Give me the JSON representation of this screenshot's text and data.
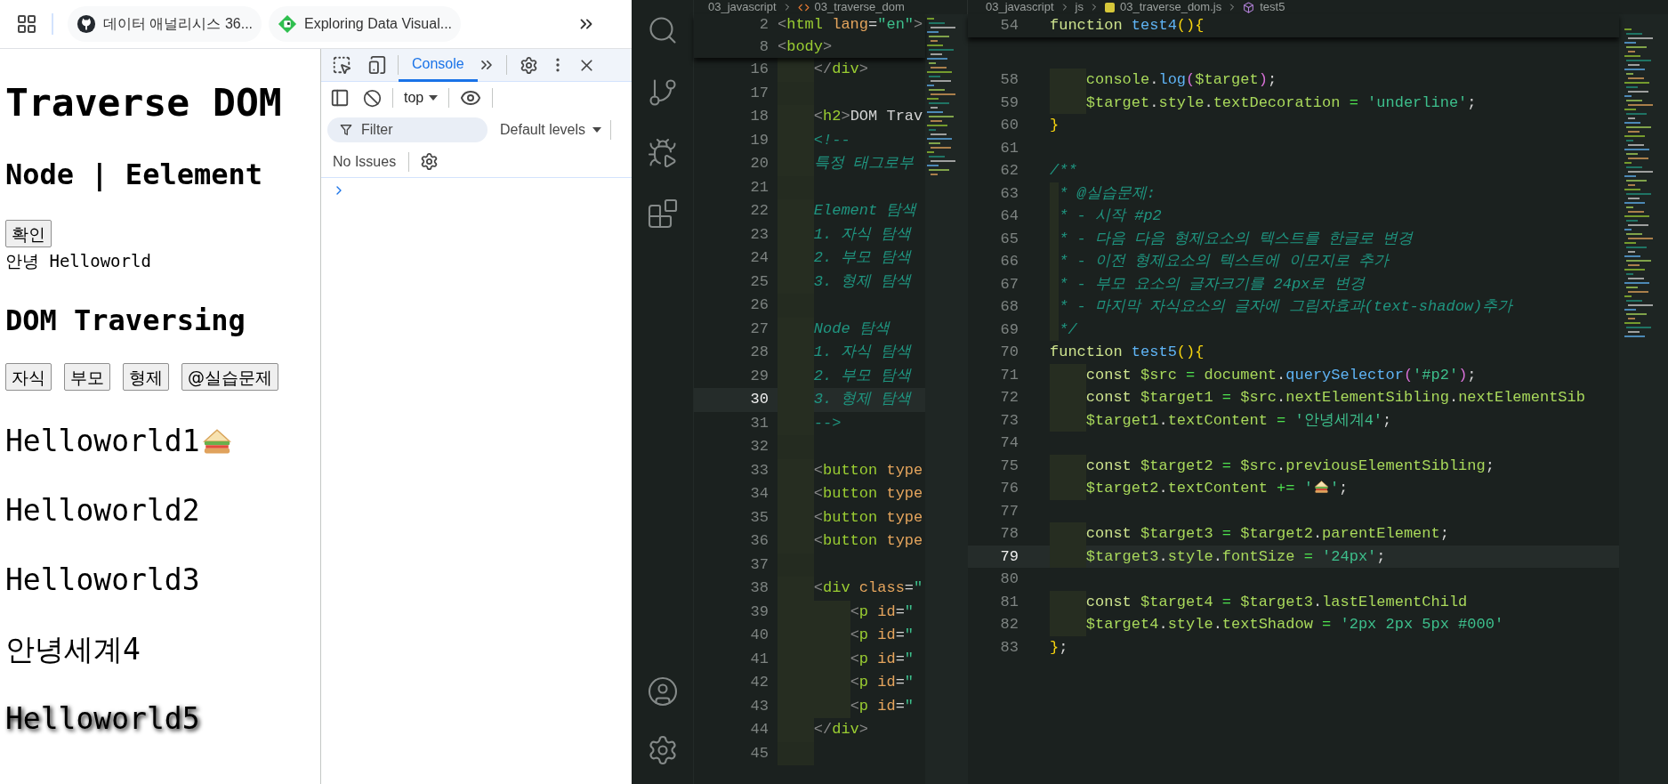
{
  "browser": {
    "bookmarks": [
      {
        "label": "데이터 애널리시스 36...",
        "kind": "github"
      },
      {
        "label": "Exploring Data Visual...",
        "kind": "site"
      }
    ],
    "page": {
      "title": "Traverse DOM",
      "subtitle": "Node | Eelement",
      "confirm_button": "확인",
      "greeting": "안녕 Helloworld",
      "section_title": "DOM Traversing",
      "buttons": [
        "자식",
        "부모",
        "형제",
        "@실습문제"
      ],
      "paragraphs": [
        {
          "text": "Helloworld1",
          "trailing_icon": true,
          "shadow": false
        },
        {
          "text": "Helloworld2",
          "trailing_icon": false,
          "shadow": false
        },
        {
          "text": "Helloworld3",
          "trailing_icon": false,
          "shadow": false
        },
        {
          "text": "안녕세계4",
          "trailing_icon": false,
          "shadow": false
        },
        {
          "text": "Helloworld5",
          "trailing_icon": false,
          "shadow": true
        }
      ]
    },
    "devtools": {
      "tabs": [
        {
          "label": "Console",
          "selected": true
        }
      ],
      "context": "top",
      "filter": {
        "placeholder": "Filter"
      },
      "levels": "Default levels",
      "issues": "No Issues"
    }
  },
  "editor": {
    "left": {
      "breadcrumb": [
        {
          "label": "03_javascript",
          "kind": "folder"
        },
        {
          "label": "03_traverse_dom",
          "kind": "html"
        }
      ],
      "sticky": [
        {
          "number": "2",
          "current": false,
          "code": [
            {
              "text": "<",
              "kind": "angle"
            },
            {
              "text": "html",
              "kind": "tag"
            },
            {
              "text": " lang",
              "kind": "attr"
            },
            {
              "text": "=",
              "kind": "punct"
            },
            {
              "text": "\"en\"",
              "kind": "str"
            },
            {
              "text": ">",
              "kind": "angle"
            }
          ]
        },
        {
          "number": "8",
          "current": false,
          "code": [
            {
              "text": "<",
              "kind": "angle"
            },
            {
              "text": "body",
              "kind": "tag"
            },
            {
              "text": ">",
              "kind": "angle"
            }
          ]
        }
      ],
      "lines": [
        {
          "number": "16",
          "current": false,
          "code": [
            {
              "text": "    </",
              "kind": "angle"
            },
            {
              "text": "div",
              "kind": "tag"
            },
            {
              "text": ">",
              "kind": "angle"
            }
          ]
        },
        {
          "number": "17",
          "current": false
        },
        {
          "number": "18",
          "current": false,
          "code": [
            {
              "text": "    <",
              "kind": "angle"
            },
            {
              "text": "h2",
              "kind": "tag"
            },
            {
              "text": ">",
              "kind": "angle"
            },
            {
              "text": "DOM Trav",
              "kind": "text"
            }
          ]
        },
        {
          "number": "19",
          "current": false,
          "code": [
            {
              "text": "    <!--",
              "kind": "comment"
            }
          ]
        },
        {
          "number": "20",
          "current": false,
          "code": [
            {
              "text": "    특정 태그로부",
              "kind": "comment"
            }
          ]
        },
        {
          "number": "21",
          "current": false
        },
        {
          "number": "22",
          "current": false,
          "code": [
            {
              "text": "    Element 탐색",
              "kind": "comment"
            }
          ]
        },
        {
          "number": "23",
          "current": false,
          "code": [
            {
              "text": "    1. 자식 탐색",
              "kind": "comment"
            }
          ]
        },
        {
          "number": "24",
          "current": false,
          "code": [
            {
              "text": "    2. 부모 탐색",
              "kind": "comment"
            }
          ]
        },
        {
          "number": "25",
          "current": false,
          "code": [
            {
              "text": "    3. 형제 탐색",
              "kind": "comment"
            }
          ]
        },
        {
          "number": "26",
          "current": false
        },
        {
          "number": "27",
          "current": false,
          "code": [
            {
              "text": "    Node 탐색",
              "kind": "comment"
            }
          ]
        },
        {
          "number": "28",
          "current": false,
          "code": [
            {
              "text": "    1. 자식 탐색",
              "kind": "comment"
            }
          ]
        },
        {
          "number": "29",
          "current": false,
          "code": [
            {
              "text": "    2. 부모 탐색",
              "kind": "comment"
            }
          ]
        },
        {
          "number": "30",
          "current": true,
          "code": [
            {
              "text": "    3. 형제 탐색",
              "kind": "comment"
            }
          ]
        },
        {
          "number": "31",
          "current": false,
          "code": [
            {
              "text": "    -->",
              "kind": "comment"
            }
          ]
        },
        {
          "number": "32",
          "current": false
        },
        {
          "number": "33",
          "current": false,
          "code": [
            {
              "text": "    <",
              "kind": "angle"
            },
            {
              "text": "button",
              "kind": "tag"
            },
            {
              "text": " type",
              "kind": "attr"
            }
          ]
        },
        {
          "number": "34",
          "current": false,
          "code": [
            {
              "text": "    <",
              "kind": "angle"
            },
            {
              "text": "button",
              "kind": "tag"
            },
            {
              "text": " type",
              "kind": "attr"
            }
          ]
        },
        {
          "number": "35",
          "current": false,
          "code": [
            {
              "text": "    <",
              "kind": "angle"
            },
            {
              "text": "button",
              "kind": "tag"
            },
            {
              "text": " type",
              "kind": "attr"
            }
          ]
        },
        {
          "number": "36",
          "current": false,
          "code": [
            {
              "text": "    <",
              "kind": "angle"
            },
            {
              "text": "button",
              "kind": "tag"
            },
            {
              "text": " type",
              "kind": "attr"
            }
          ]
        },
        {
          "number": "37",
          "current": false
        },
        {
          "number": "38",
          "current": false,
          "code": [
            {
              "text": "    <",
              "kind": "angle"
            },
            {
              "text": "div",
              "kind": "tag"
            },
            {
              "text": " class",
              "kind": "attr"
            },
            {
              "text": "=",
              "kind": "punct"
            },
            {
              "text": "\"",
              "kind": "str"
            }
          ]
        },
        {
          "number": "39",
          "current": false,
          "code": [
            {
              "text": "        <",
              "kind": "angle"
            },
            {
              "text": "p",
              "kind": "tag"
            },
            {
              "text": " id",
              "kind": "attr"
            },
            {
              "text": "=",
              "kind": "punct"
            },
            {
              "text": "\"",
              "kind": "str"
            }
          ]
        },
        {
          "number": "40",
          "current": false,
          "code": [
            {
              "text": "        <",
              "kind": "angle"
            },
            {
              "text": "p",
              "kind": "tag"
            },
            {
              "text": " id",
              "kind": "attr"
            },
            {
              "text": "=",
              "kind": "punct"
            },
            {
              "text": "\"",
              "kind": "str"
            }
          ]
        },
        {
          "number": "41",
          "current": false,
          "code": [
            {
              "text": "        <",
              "kind": "angle"
            },
            {
              "text": "p",
              "kind": "tag"
            },
            {
              "text": " id",
              "kind": "attr"
            },
            {
              "text": "=",
              "kind": "punct"
            },
            {
              "text": "\"",
              "kind": "str"
            }
          ]
        },
        {
          "number": "42",
          "current": false,
          "code": [
            {
              "text": "        <",
              "kind": "angle"
            },
            {
              "text": "p",
              "kind": "tag"
            },
            {
              "text": " id",
              "kind": "attr"
            },
            {
              "text": "=",
              "kind": "punct"
            },
            {
              "text": "\"",
              "kind": "str"
            }
          ]
        },
        {
          "number": "43",
          "current": false,
          "code": [
            {
              "text": "        <",
              "kind": "angle"
            },
            {
              "text": "p",
              "kind": "tag"
            },
            {
              "text": " id",
              "kind": "attr"
            },
            {
              "text": "=",
              "kind": "punct"
            },
            {
              "text": "\"",
              "kind": "str"
            }
          ]
        },
        {
          "number": "44",
          "current": false,
          "code": [
            {
              "text": "    </",
              "kind": "angle"
            },
            {
              "text": "div",
              "kind": "tag"
            },
            {
              "text": ">",
              "kind": "angle"
            }
          ]
        },
        {
          "number": "45",
          "current": false
        }
      ]
    },
    "right": {
      "breadcrumb": [
        {
          "label": "03_javascript",
          "kind": "folder"
        },
        {
          "label": "js",
          "kind": "folder"
        },
        {
          "label": "03_traverse_dom.js",
          "kind": "js"
        },
        {
          "label": "test5",
          "kind": "function"
        }
      ],
      "sticky": [
        {
          "number": "54",
          "current": false,
          "code": [
            {
              "text": "function",
              "kind": "kw"
            },
            {
              "text": " test4",
              "kind": "fn"
            },
            {
              "text": "(){",
              "kind": "brace"
            }
          ]
        }
      ],
      "lines": [
        {
          "number": "58",
          "current": false,
          "code": [
            {
              "text": "    console",
              "kind": "var"
            },
            {
              "text": ".",
              "kind": "punct"
            },
            {
              "text": "log",
              "kind": "fn"
            },
            {
              "text": "(",
              "kind": "paren"
            },
            {
              "text": "$target",
              "kind": "var"
            },
            {
              "text": ")",
              "kind": "paren"
            },
            {
              "text": ";",
              "kind": "punct"
            }
          ]
        },
        {
          "number": "59",
          "current": false,
          "code": [
            {
              "text": "    $target",
              "kind": "var"
            },
            {
              "text": ".",
              "kind": "punct"
            },
            {
              "text": "style",
              "kind": "var"
            },
            {
              "text": ".",
              "kind": "punct"
            },
            {
              "text": "textDecoration",
              "kind": "var"
            },
            {
              "text": " = ",
              "kind": "op"
            },
            {
              "text": "'underline'",
              "kind": "str"
            },
            {
              "text": ";",
              "kind": "punct"
            }
          ]
        },
        {
          "number": "60",
          "current": false,
          "code": [
            {
              "text": "}",
              "kind": "brace"
            }
          ]
        },
        {
          "number": "61",
          "current": false
        },
        {
          "number": "62",
          "current": false,
          "code": [
            {
              "text": "/**",
              "kind": "comment"
            }
          ]
        },
        {
          "number": "63",
          "current": false,
          "code": [
            {
              "text": " * @실습문제:",
              "kind": "comment"
            }
          ]
        },
        {
          "number": "64",
          "current": false,
          "code": [
            {
              "text": " * - 시작 #p2",
              "kind": "comment"
            }
          ]
        },
        {
          "number": "65",
          "current": false,
          "code": [
            {
              "text": " * - 다음 다음 형제요소의 텍스트를 한글로 변경",
              "kind": "comment"
            }
          ]
        },
        {
          "number": "66",
          "current": false,
          "code": [
            {
              "text": " * - 이전 형제요소의 텍스트에 이모지로 추가",
              "kind": "comment"
            }
          ]
        },
        {
          "number": "67",
          "current": false,
          "code": [
            {
              "text": " * - 부모 요소의 글자크기를 24px로 변경",
              "kind": "comment"
            }
          ]
        },
        {
          "number": "68",
          "current": false,
          "code": [
            {
              "text": " * - 마지막 자식요소의 글자에 그림자효과(text-shadow)추가",
              "kind": "comment"
            }
          ]
        },
        {
          "number": "69",
          "current": false,
          "code": [
            {
              "text": " */",
              "kind": "comment"
            }
          ]
        },
        {
          "number": "70",
          "current": false,
          "code": [
            {
              "text": "function",
              "kind": "kw"
            },
            {
              "text": " test5",
              "kind": "fn"
            },
            {
              "text": "(){",
              "kind": "brace"
            }
          ]
        },
        {
          "number": "71",
          "current": false,
          "code": [
            {
              "text": "    const",
              "kind": "kw"
            },
            {
              "text": " $src",
              "kind": "var"
            },
            {
              "text": " = ",
              "kind": "op"
            },
            {
              "text": "document",
              "kind": "var"
            },
            {
              "text": ".",
              "kind": "punct"
            },
            {
              "text": "querySelector",
              "kind": "fn"
            },
            {
              "text": "(",
              "kind": "paren"
            },
            {
              "text": "'#p2'",
              "kind": "str"
            },
            {
              "text": ")",
              "kind": "paren"
            },
            {
              "text": ";",
              "kind": "punct"
            }
          ]
        },
        {
          "number": "72",
          "current": false,
          "code": [
            {
              "text": "    const",
              "kind": "kw"
            },
            {
              "text": " $target1",
              "kind": "var"
            },
            {
              "text": " = ",
              "kind": "op"
            },
            {
              "text": "$src",
              "kind": "var"
            },
            {
              "text": ".",
              "kind": "punct"
            },
            {
              "text": "nextElementSibling",
              "kind": "var"
            },
            {
              "text": ".",
              "kind": "punct"
            },
            {
              "text": "nextElementSib",
              "kind": "var"
            }
          ]
        },
        {
          "number": "73",
          "current": false,
          "code": [
            {
              "text": "    $target1",
              "kind": "var"
            },
            {
              "text": ".",
              "kind": "punct"
            },
            {
              "text": "textContent",
              "kind": "var"
            },
            {
              "text": " = ",
              "kind": "op"
            },
            {
              "text": "'안녕세계4'",
              "kind": "str"
            },
            {
              "text": ";",
              "kind": "punct"
            }
          ]
        },
        {
          "number": "74",
          "current": false
        },
        {
          "number": "75",
          "current": false,
          "code": [
            {
              "text": "    const",
              "kind": "kw"
            },
            {
              "text": " $target2",
              "kind": "var"
            },
            {
              "text": " = ",
              "kind": "op"
            },
            {
              "text": "$src",
              "kind": "var"
            },
            {
              "text": ".",
              "kind": "punct"
            },
            {
              "text": "previousElementSibling",
              "kind": "var"
            },
            {
              "text": ";",
              "kind": "punct"
            }
          ]
        },
        {
          "number": "76",
          "current": false,
          "code": [
            {
              "text": "    $target2",
              "kind": "var"
            },
            {
              "text": ".",
              "kind": "punct"
            },
            {
              "text": "textContent",
              "kind": "var"
            },
            {
              "text": " += ",
              "kind": "op"
            },
            {
              "text": "'",
              "kind": "str"
            },
            {
              "kind": "icon"
            },
            {
              "text": "'",
              "kind": "str"
            },
            {
              "text": ";",
              "kind": "punct"
            }
          ]
        },
        {
          "number": "77",
          "current": false
        },
        {
          "number": "78",
          "current": false,
          "code": [
            {
              "text": "    const",
              "kind": "kw"
            },
            {
              "text": " $target3",
              "kind": "var"
            },
            {
              "text": " = ",
              "kind": "op"
            },
            {
              "text": "$target2",
              "kind": "var"
            },
            {
              "text": ".",
              "kind": "punct"
            },
            {
              "text": "parentElement",
              "kind": "var"
            },
            {
              "text": ";",
              "kind": "punct"
            }
          ]
        },
        {
          "number": "79",
          "current": true,
          "code": [
            {
              "text": "    $target3",
              "kind": "var"
            },
            {
              "text": ".",
              "kind": "punct"
            },
            {
              "text": "style",
              "kind": "var"
            },
            {
              "text": ".",
              "kind": "punct"
            },
            {
              "text": "fontSize",
              "kind": "var"
            },
            {
              "text": " = ",
              "kind": "op"
            },
            {
              "text": "'24px'",
              "kind": "str"
            },
            {
              "text": ";",
              "kind": "punct"
            }
          ]
        },
        {
          "number": "80",
          "current": false
        },
        {
          "number": "81",
          "current": false,
          "code": [
            {
              "text": "    const",
              "kind": "kw"
            },
            {
              "text": " $target4",
              "kind": "var"
            },
            {
              "text": " = ",
              "kind": "op"
            },
            {
              "text": "$target3",
              "kind": "var"
            },
            {
              "text": ".",
              "kind": "punct"
            },
            {
              "text": "lastElementChild",
              "kind": "var"
            }
          ]
        },
        {
          "number": "82",
          "current": false,
          "code": [
            {
              "text": "    $target4",
              "kind": "var"
            },
            {
              "text": ".",
              "kind": "punct"
            },
            {
              "text": "style",
              "kind": "var"
            },
            {
              "text": ".",
              "kind": "punct"
            },
            {
              "text": "textShadow",
              "kind": "var"
            },
            {
              "text": " = ",
              "kind": "op"
            },
            {
              "text": "'2px 2px 5px #000'",
              "kind": "str"
            }
          ]
        },
        {
          "number": "83",
          "current": false,
          "code": [
            {
              "text": "}",
              "kind": "brace"
            },
            {
              "text": ";",
              "kind": "punct"
            }
          ]
        }
      ]
    }
  }
}
